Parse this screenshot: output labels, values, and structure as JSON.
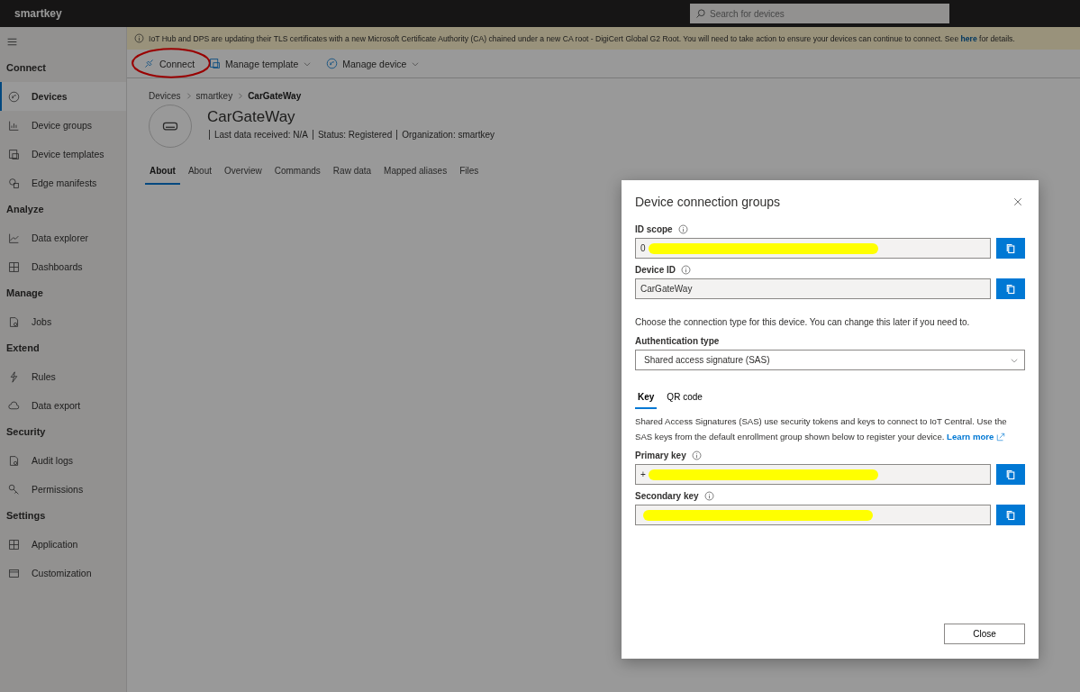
{
  "app": {
    "title": "smartkey",
    "search": {
      "placeholder": "Search for devices"
    }
  },
  "banner": {
    "text": "IoT Hub and DPS are updating their TLS certificates with a new Microsoft Certificate Authority (CA) chained under a new CA root - DigiCert Global G2 Root. You will need to take action to ensure your devices can continue to connect. See",
    "link": "here",
    "after": "for details."
  },
  "sidebar": {
    "sections": [
      {
        "title": "Connect",
        "items": [
          {
            "label": "Devices",
            "selected": true
          },
          {
            "label": "Device groups",
            "selected": false
          },
          {
            "label": "Device templates",
            "selected": false
          },
          {
            "label": "Edge manifests",
            "selected": false
          }
        ]
      },
      {
        "title": "Analyze",
        "items": [
          {
            "label": "Data explorer",
            "selected": false
          },
          {
            "label": "Dashboards",
            "selected": false
          }
        ]
      },
      {
        "title": "Manage",
        "items": [
          {
            "label": "Jobs",
            "selected": false
          }
        ]
      },
      {
        "title": "Extend",
        "items": [
          {
            "label": "Rules",
            "selected": false
          },
          {
            "label": "Data export",
            "selected": false
          }
        ]
      },
      {
        "title": "Security",
        "items": [
          {
            "label": "Audit logs",
            "selected": false
          },
          {
            "label": "Permissions",
            "selected": false
          }
        ]
      },
      {
        "title": "Settings",
        "items": [
          {
            "label": "Application",
            "selected": false
          },
          {
            "label": "Customization",
            "selected": false
          }
        ]
      }
    ]
  },
  "toolbar": [
    {
      "label": "Connect",
      "dropdown": false,
      "circled": true
    },
    {
      "label": "Manage template",
      "dropdown": true,
      "circled": false
    },
    {
      "label": "Manage device",
      "dropdown": true,
      "circled": false
    }
  ],
  "breadcrumb": [
    {
      "label": "Devices",
      "current": false
    },
    {
      "label": "smartkey",
      "current": false
    },
    {
      "label": "CarGateWay",
      "current": true
    }
  ],
  "device": {
    "name": "CarGateWay",
    "meta": [
      "Last data received: N/A",
      "Status: Registered",
      "Organization: smartkey"
    ]
  },
  "tabs": [
    {
      "label": "About",
      "selected": true
    },
    {
      "label": "About",
      "selected": false
    },
    {
      "label": "Overview",
      "selected": false
    },
    {
      "label": "Commands",
      "selected": false
    },
    {
      "label": "Raw data",
      "selected": false
    },
    {
      "label": "Mapped aliases",
      "selected": false
    },
    {
      "label": "Files",
      "selected": false
    }
  ],
  "dialog": {
    "title": "Device connection groups",
    "fields": [
      {
        "label": "ID scope",
        "value": "0",
        "redacted": true
      },
      {
        "label": "Device ID",
        "value": "CarGateWay",
        "redacted": false
      }
    ],
    "intro": "Choose the connection type for this device. You can change this later if you need to.",
    "auth": {
      "label": "Authentication type",
      "value": "Shared access signature (SAS)"
    },
    "tabs": [
      {
        "label": "Key",
        "selected": true
      },
      {
        "label": "QR code",
        "selected": false
      }
    ],
    "description": "Shared Access Signatures (SAS) use security tokens and keys to connect to IoT Central. Use the SAS keys from the default enrollment group shown below to register your device.",
    "learn_more": "Learn more",
    "keys": [
      {
        "label": "Primary key",
        "value": "+",
        "redacted": true
      },
      {
        "label": "Secondary key",
        "redacted": true
      }
    ],
    "close": "Close"
  }
}
